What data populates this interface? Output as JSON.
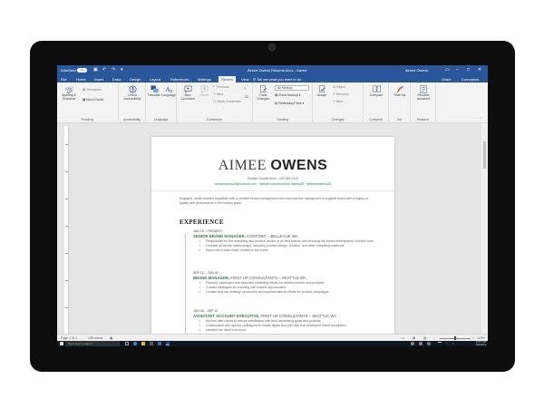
{
  "titlebar": {
    "autosave_label": "AutoSave",
    "autosave_state": "On",
    "doc_title": "Aimee Owens Resume.docx - Saved",
    "user": "Aimee Owens"
  },
  "tabs": [
    "File",
    "Home",
    "Insert",
    "Draw",
    "Design",
    "Layout",
    "References",
    "Mailings",
    "Review",
    "View"
  ],
  "active_tab": "Review",
  "tell_me": "Tell me what you want to do",
  "share_label": "Share",
  "comments_label": "Comments",
  "ribbon": {
    "proofing": {
      "label": "Proofing",
      "spelling": "Spelling & Grammar",
      "thesaurus": "Thesaurus",
      "word_count": "Word Count"
    },
    "accessibility": {
      "label": "Accessibility",
      "check": "Check Accessibility"
    },
    "language": {
      "label": "Language",
      "translate": "Translate",
      "language": "Language"
    },
    "comments": {
      "label": "Comments",
      "new_comment": "New Comment",
      "delete": "Delete",
      "previous": "Previous",
      "next": "Next",
      "show_comments": "Show Comments"
    },
    "tracking": {
      "label": "Tracking",
      "track_changes": "Track Changes",
      "markup": "All Markup",
      "show_markup": "Show Markup",
      "reviewing_pane": "Reviewing Pane"
    },
    "changes": {
      "label": "Changes",
      "accept": "Accept",
      "reject": "Reject",
      "previous": "Previous",
      "next": "Next"
    },
    "compare": {
      "label": "Compare",
      "compare": "Compare"
    },
    "ink": {
      "label": "Ink",
      "hide_ink": "Hide Ink"
    },
    "resume": {
      "label": "Resume",
      "assistant": "Resume Assistant"
    }
  },
  "document": {
    "first_name": "AIMEE",
    "last_name": "OWENS",
    "contact": "Greater Seattle Area · 425.555.0100",
    "links": "aimeeowens25@outlook.com · linkedin.com/in/aimee-owens25 · @aimeeowens25",
    "objective": "Engaged, detail oriented candidate with a creative brand management and client service background in a global brand with a legacy of quality and performance in the market place.",
    "section_title": "EXPERIENCE",
    "jobs": [
      {
        "dates": "JUN 15 – PRESENT",
        "role": "SENIOR BRAND MANAGER,",
        "company": "CONTOSO – BELLEVUE WA",
        "bullets": [
          "Responsible for the marketing and product launch of all new brands and ensuring the brand development of brand lines.",
          "Oversee all vendor relationships, including product design, creation, and other marketing materials.",
          "Supervise a brand team related to the brand."
        ]
      },
      {
        "dates": "SEP 12 – JUN 15",
        "role": "BRAND MANAGER,",
        "company": "FIRST UP CONSULTANTS – SEATTLE WA",
        "bullets": [
          "Planned, developed and executed marketing efforts for various brands and products.",
          "Created strategies for branding with market opportunities.",
          "Created and ran strategy, production and implemented all efforts for product campaigns."
        ]
      },
      {
        "dates": "JUN 08 – SEP 12",
        "role": "ASSISTANT ACCOUNT EXECUTIVE,",
        "company": "FIRST UP CONSULTANTS – SEATTLE WA",
        "bullets": [
          "Worked with clients to ensure satisfaction with their advertising goals and projects.",
          "Collaborated with agency colleagues to create digital and print ads that developed brand recognition.",
          "Handled the client's account."
        ]
      }
    ]
  },
  "status": {
    "page": "Page 1 of 1",
    "words": "125 words",
    "zoom": "110%"
  },
  "taskbar": {
    "search_placeholder": "Type here to search",
    "time": "10:07 AM",
    "date": "1/10/2019"
  }
}
